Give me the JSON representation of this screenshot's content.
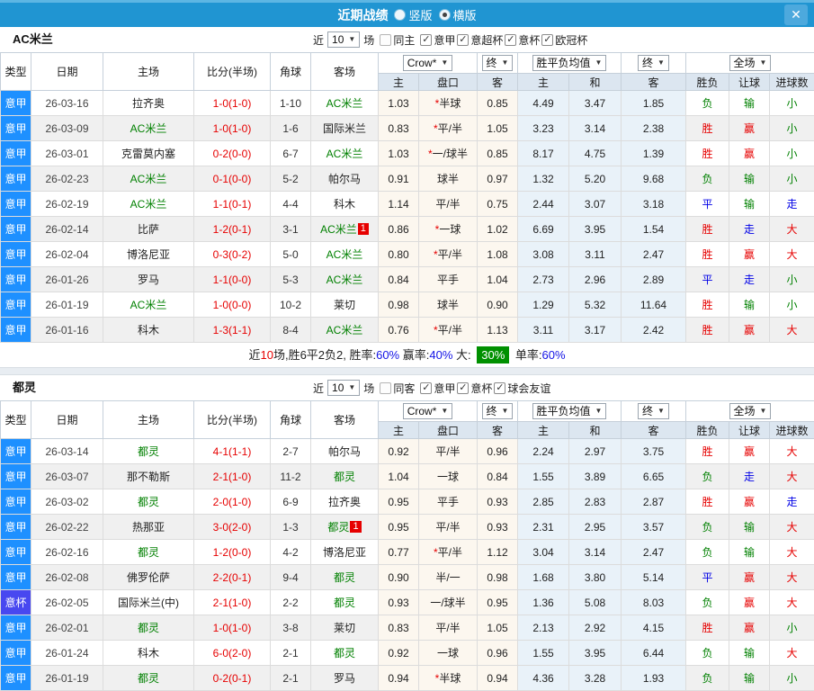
{
  "window": {
    "title": "近期战绩",
    "radios": [
      {
        "label": "竖版",
        "selected": false
      },
      {
        "label": "横版",
        "selected": true
      }
    ],
    "close_icon": "✕"
  },
  "table_columns": {
    "type": "类型",
    "date": "日期",
    "home": "主场",
    "score": "比分(半场)",
    "corner": "角球",
    "away": "客场",
    "odds_home": "主",
    "odds_handicap": "盘口",
    "odds_away": "客",
    "avg_home": "主",
    "avg_draw": "和",
    "avg_away": "客",
    "result": "胜负",
    "handicap_result": "让球",
    "goals": "进球数"
  },
  "colors": {
    "type_league": {
      "意甲": "#1e90ff",
      "意杯": "#4848f0"
    },
    "word": {
      "胜": "#e60000",
      "赢": "#e60000",
      "大": "#e60000",
      "负": "#008000",
      "输": "#008000",
      "小": "#008000",
      "平": "#0000e6",
      "走": "#0000e6"
    }
  },
  "sections": [
    {
      "team": "AC米兰",
      "filter": {
        "near": "近",
        "count": "10",
        "matches": "场",
        "same": {
          "label": "同主",
          "checked": false
        },
        "competitions": [
          {
            "label": "意甲",
            "checked": true
          },
          {
            "label": "意超杯",
            "checked": true
          },
          {
            "label": "意杯",
            "checked": true
          },
          {
            "label": "欧冠杯",
            "checked": true
          }
        ]
      },
      "dropdowns": {
        "bookmaker": "Crow*",
        "final_a": "终",
        "average": "胜平负均值",
        "final_b": "终",
        "scope": "全场"
      },
      "rows": [
        {
          "type": "意甲",
          "date": "26-03-16",
          "home": "拉齐奥",
          "home_hl": false,
          "home_badge": "",
          "score": "1-0(1-0)",
          "corner": "1-10",
          "away": "AC米兰",
          "away_hl": true,
          "away_badge": "",
          "odds": [
            "1.03",
            "*半球",
            "0.85"
          ],
          "avg": [
            "4.49",
            "3.47",
            "1.85"
          ],
          "outcome": [
            "负",
            "输",
            "小"
          ]
        },
        {
          "type": "意甲",
          "date": "26-03-09",
          "home": "AC米兰",
          "home_hl": true,
          "home_badge": "",
          "score": "1-0(1-0)",
          "corner": "1-6",
          "away": "国际米兰",
          "away_hl": false,
          "away_badge": "",
          "odds": [
            "0.83",
            "*平/半",
            "1.05"
          ],
          "avg": [
            "3.23",
            "3.14",
            "2.38"
          ],
          "outcome": [
            "胜",
            "赢",
            "小"
          ]
        },
        {
          "type": "意甲",
          "date": "26-03-01",
          "home": "克雷莫内塞",
          "home_hl": false,
          "home_badge": "",
          "score": "0-2(0-0)",
          "corner": "6-7",
          "away": "AC米兰",
          "away_hl": true,
          "away_badge": "",
          "odds": [
            "1.03",
            "*一/球半",
            "0.85"
          ],
          "avg": [
            "8.17",
            "4.75",
            "1.39"
          ],
          "outcome": [
            "胜",
            "赢",
            "小"
          ]
        },
        {
          "type": "意甲",
          "date": "26-02-23",
          "home": "AC米兰",
          "home_hl": true,
          "home_badge": "",
          "score": "0-1(0-0)",
          "corner": "5-2",
          "away": "帕尔马",
          "away_hl": false,
          "away_badge": "",
          "odds": [
            "0.91",
            "球半",
            "0.97"
          ],
          "avg": [
            "1.32",
            "5.20",
            "9.68"
          ],
          "outcome": [
            "负",
            "输",
            "小"
          ]
        },
        {
          "type": "意甲",
          "date": "26-02-19",
          "home": "AC米兰",
          "home_hl": true,
          "home_badge": "",
          "score": "1-1(0-1)",
          "corner": "4-4",
          "away": "科木",
          "away_hl": false,
          "away_badge": "",
          "odds": [
            "1.14",
            "平/半",
            "0.75"
          ],
          "avg": [
            "2.44",
            "3.07",
            "3.18"
          ],
          "outcome": [
            "平",
            "输",
            "走"
          ]
        },
        {
          "type": "意甲",
          "date": "26-02-14",
          "home": "比萨",
          "home_hl": false,
          "home_badge": "",
          "score": "1-2(0-1)",
          "corner": "3-1",
          "away": "AC米兰",
          "away_hl": true,
          "away_badge": "1",
          "odds": [
            "0.86",
            "*一球",
            "1.02"
          ],
          "avg": [
            "6.69",
            "3.95",
            "1.54"
          ],
          "outcome": [
            "胜",
            "走",
            "大"
          ]
        },
        {
          "type": "意甲",
          "date": "26-02-04",
          "home": "博洛尼亚",
          "home_hl": false,
          "home_badge": "",
          "score": "0-3(0-2)",
          "corner": "5-0",
          "away": "AC米兰",
          "away_hl": true,
          "away_badge": "",
          "odds": [
            "0.80",
            "*平/半",
            "1.08"
          ],
          "avg": [
            "3.08",
            "3.11",
            "2.47"
          ],
          "outcome": [
            "胜",
            "赢",
            "大"
          ]
        },
        {
          "type": "意甲",
          "date": "26-01-26",
          "home": "罗马",
          "home_hl": false,
          "home_badge": "",
          "score": "1-1(0-0)",
          "corner": "5-3",
          "away": "AC米兰",
          "away_hl": true,
          "away_badge": "",
          "odds": [
            "0.84",
            "平手",
            "1.04"
          ],
          "avg": [
            "2.73",
            "2.96",
            "2.89"
          ],
          "outcome": [
            "平",
            "走",
            "小"
          ]
        },
        {
          "type": "意甲",
          "date": "26-01-19",
          "home": "AC米兰",
          "home_hl": true,
          "home_badge": "",
          "score": "1-0(0-0)",
          "corner": "10-2",
          "away": "莱切",
          "away_hl": false,
          "away_badge": "",
          "odds": [
            "0.98",
            "球半",
            "0.90"
          ],
          "avg": [
            "1.29",
            "5.32",
            "11.64"
          ],
          "outcome": [
            "胜",
            "输",
            "小"
          ]
        },
        {
          "type": "意甲",
          "date": "26-01-16",
          "home": "科木",
          "home_hl": false,
          "home_badge": "",
          "score": "1-3(1-1)",
          "corner": "8-4",
          "away": "AC米兰",
          "away_hl": true,
          "away_badge": "",
          "odds": [
            "0.76",
            "*平/半",
            "1.13"
          ],
          "avg": [
            "3.11",
            "3.17",
            "2.42"
          ],
          "outcome": [
            "胜",
            "赢",
            "大"
          ]
        }
      ],
      "summary": {
        "segments": [
          {
            "text": "近",
            "style": "plain"
          },
          {
            "text": "10",
            "style": "red"
          },
          {
            "text": "场,胜6平2负2, 胜率:",
            "style": "plain"
          },
          {
            "text": "60%",
            "style": "blue"
          },
          {
            "text": " 赢率:",
            "style": "plain"
          },
          {
            "text": "40%",
            "style": "blue"
          },
          {
            "text": " 大: ",
            "style": "plain"
          },
          {
            "text": "30%",
            "style": "badge"
          },
          {
            "text": " 单率:",
            "style": "plain"
          },
          {
            "text": "60%",
            "style": "blue"
          }
        ]
      }
    },
    {
      "team": "都灵",
      "filter": {
        "near": "近",
        "count": "10",
        "matches": "场",
        "same": {
          "label": "同客",
          "checked": false
        },
        "competitions": [
          {
            "label": "意甲",
            "checked": true
          },
          {
            "label": "意杯",
            "checked": true
          },
          {
            "label": "球会友谊",
            "checked": true
          }
        ]
      },
      "dropdowns": {
        "bookmaker": "Crow*",
        "final_a": "终",
        "average": "胜平负均值",
        "final_b": "终",
        "scope": "全场"
      },
      "rows": [
        {
          "type": "意甲",
          "date": "26-03-14",
          "home": "都灵",
          "home_hl": true,
          "home_badge": "",
          "score": "4-1(1-1)",
          "corner": "2-7",
          "away": "帕尔马",
          "away_hl": false,
          "away_badge": "",
          "odds": [
            "0.92",
            "平/半",
            "0.96"
          ],
          "avg": [
            "2.24",
            "2.97",
            "3.75"
          ],
          "outcome": [
            "胜",
            "赢",
            "大"
          ]
        },
        {
          "type": "意甲",
          "date": "26-03-07",
          "home": "那不勒斯",
          "home_hl": false,
          "home_badge": "",
          "score": "2-1(1-0)",
          "corner": "11-2",
          "away": "都灵",
          "away_hl": true,
          "away_badge": "",
          "odds": [
            "1.04",
            "一球",
            "0.84"
          ],
          "avg": [
            "1.55",
            "3.89",
            "6.65"
          ],
          "outcome": [
            "负",
            "走",
            "大"
          ]
        },
        {
          "type": "意甲",
          "date": "26-03-02",
          "home": "都灵",
          "home_hl": true,
          "home_badge": "",
          "score": "2-0(1-0)",
          "corner": "6-9",
          "away": "拉齐奥",
          "away_hl": false,
          "away_badge": "",
          "odds": [
            "0.95",
            "平手",
            "0.93"
          ],
          "avg": [
            "2.85",
            "2.83",
            "2.87"
          ],
          "outcome": [
            "胜",
            "赢",
            "走"
          ]
        },
        {
          "type": "意甲",
          "date": "26-02-22",
          "home": "热那亚",
          "home_hl": false,
          "home_badge": "",
          "score": "3-0(2-0)",
          "corner": "1-3",
          "away": "都灵",
          "away_hl": true,
          "away_badge": "1",
          "odds": [
            "0.95",
            "平/半",
            "0.93"
          ],
          "avg": [
            "2.31",
            "2.95",
            "3.57"
          ],
          "outcome": [
            "负",
            "输",
            "大"
          ]
        },
        {
          "type": "意甲",
          "date": "26-02-16",
          "home": "都灵",
          "home_hl": true,
          "home_badge": "",
          "score": "1-2(0-0)",
          "corner": "4-2",
          "away": "博洛尼亚",
          "away_hl": false,
          "away_badge": "",
          "odds": [
            "0.77",
            "*平/半",
            "1.12"
          ],
          "avg": [
            "3.04",
            "3.14",
            "2.47"
          ],
          "outcome": [
            "负",
            "输",
            "大"
          ]
        },
        {
          "type": "意甲",
          "date": "26-02-08",
          "home": "佛罗伦萨",
          "home_hl": false,
          "home_badge": "",
          "score": "2-2(0-1)",
          "corner": "9-4",
          "away": "都灵",
          "away_hl": true,
          "away_badge": "",
          "odds": [
            "0.90",
            "半/一",
            "0.98"
          ],
          "avg": [
            "1.68",
            "3.80",
            "5.14"
          ],
          "outcome": [
            "平",
            "赢",
            "大"
          ]
        },
        {
          "type": "意杯",
          "date": "26-02-05",
          "home": "国际米兰(中)",
          "home_hl": false,
          "home_badge": "",
          "score": "2-1(1-0)",
          "corner": "2-2",
          "away": "都灵",
          "away_hl": true,
          "away_badge": "",
          "odds": [
            "0.93",
            "一/球半",
            "0.95"
          ],
          "avg": [
            "1.36",
            "5.08",
            "8.03"
          ],
          "outcome": [
            "负",
            "赢",
            "大"
          ]
        },
        {
          "type": "意甲",
          "date": "26-02-01",
          "home": "都灵",
          "home_hl": true,
          "home_badge": "",
          "score": "1-0(1-0)",
          "corner": "3-8",
          "away": "莱切",
          "away_hl": false,
          "away_badge": "",
          "odds": [
            "0.83",
            "平/半",
            "1.05"
          ],
          "avg": [
            "2.13",
            "2.92",
            "4.15"
          ],
          "outcome": [
            "胜",
            "赢",
            "小"
          ]
        },
        {
          "type": "意甲",
          "date": "26-01-24",
          "home": "科木",
          "home_hl": false,
          "home_badge": "",
          "score": "6-0(2-0)",
          "corner": "2-1",
          "away": "都灵",
          "away_hl": true,
          "away_badge": "",
          "odds": [
            "0.92",
            "一球",
            "0.96"
          ],
          "avg": [
            "1.55",
            "3.95",
            "6.44"
          ],
          "outcome": [
            "负",
            "输",
            "大"
          ]
        },
        {
          "type": "意甲",
          "date": "26-01-19",
          "home": "都灵",
          "home_hl": true,
          "home_badge": "",
          "score": "0-2(0-1)",
          "corner": "2-1",
          "away": "罗马",
          "away_hl": false,
          "away_badge": "",
          "odds": [
            "0.94",
            "*半球",
            "0.94"
          ],
          "avg": [
            "4.36",
            "3.28",
            "1.93"
          ],
          "outcome": [
            "负",
            "输",
            "小"
          ]
        }
      ]
    }
  ]
}
